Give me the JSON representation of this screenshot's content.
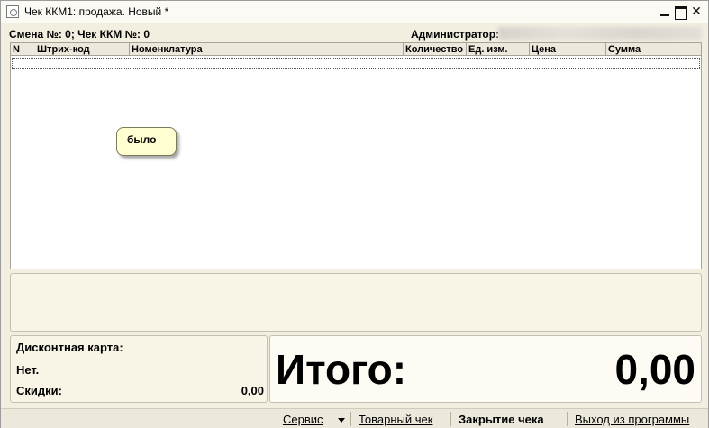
{
  "window": {
    "title": "Чек ККМ1: продажа. Новый *"
  },
  "info": {
    "shift_label": "Смена №: 0; Чек ККМ №: 0",
    "admin_label": "Администратор:"
  },
  "table": {
    "columns": [
      "N",
      "Штрих-код",
      "Номенклатура",
      "Количество",
      "Ед. изм.",
      "Цена",
      "Сумма"
    ]
  },
  "tooltip": {
    "text": "было"
  },
  "discount": {
    "card_label": "Дисконтная карта:",
    "card_value": "Нет.",
    "discounts_label": "Скидки:",
    "discounts_amount": "0,00"
  },
  "total": {
    "label": "Итого:",
    "amount": "0,00"
  },
  "bottom_bar": {
    "service_label": "Сервис",
    "receipt_label": "Товарный чек",
    "close_check_label": "Закрытие чека",
    "exit_label": "Выход из программы"
  }
}
